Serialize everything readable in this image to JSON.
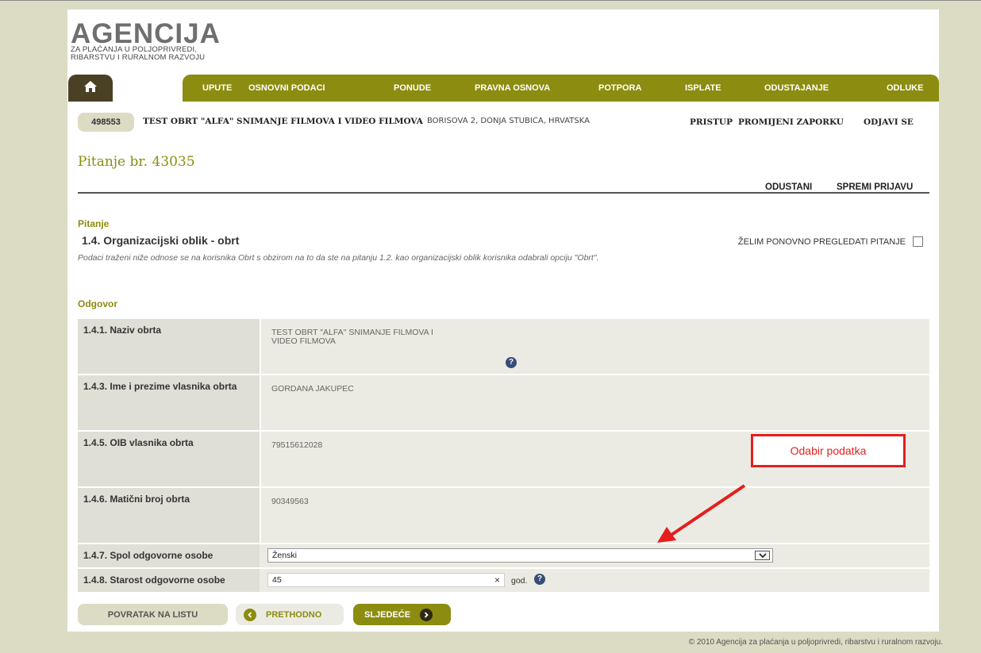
{
  "logo": {
    "main": "AGENCIJA",
    "line1": "ZA PLAĆANJA U POLJOPRIVREDI,",
    "line2": "RIBARSTVU I RURALNOM RAZVOJU"
  },
  "nav": {
    "home_icon": "home-icon",
    "items": [
      "UPUTE",
      "OSNOVNI PODACI",
      "PONUDE",
      "PRAVNA OSNOVA",
      "POTPORA",
      "ISPLATE",
      "ODUSTAJANJE",
      "ODLUKE"
    ]
  },
  "user": {
    "id": "498553",
    "name": "TEST OBRT \"ALFA\" SNIMANJE FILMOVA I VIDEO FILMOVA",
    "address": "BORISOVA 2, DONJA STUBICA, HRVATSKA",
    "links": [
      "PRISTUP",
      "PROMIJENI ZAPORKU",
      "ODJAVI SE"
    ]
  },
  "page": {
    "title": "Pitanje br. 43035",
    "actions": [
      "ODUSTANI",
      "SPREMI PRIJAVU"
    ]
  },
  "question": {
    "section_label": "Pitanje",
    "title": "1.4. Organizacijski oblik - obrt",
    "review_label": "ŽELIM PONOVNO PREGLEDATI PITANJE",
    "description": "Podaci traženi niže odnose se na korisnika Obrt s obzirom na to da ste na pitanju 1.2. kao organizacijski oblik korisnika odabrali opciju \"Obrt\"."
  },
  "answer": {
    "section_label": "Odgovor",
    "naziv": {
      "label": "1.4.1. Naziv obrta",
      "value_line1": "TEST OBRT \"ALFA\" SNIMANJE FILMOVA I",
      "value_line2": "VIDEO FILMOVA"
    },
    "ime": {
      "label": "1.4.3. Ime i prezime vlasnika obrta",
      "value": "GORDANA JAKUPEC"
    },
    "oib": {
      "label": "1.4.5. OIB vlasnika obrta",
      "value": "79515612028"
    },
    "maticni": {
      "label": "1.4.6. Matični broj obrta",
      "value": "90349563"
    },
    "spol": {
      "label": "1.4.7. Spol odgovorne osobe",
      "selected": "Ženski"
    },
    "starost": {
      "label": "1.4.8. Starost odgovorne osobe",
      "value": "45",
      "clear": "×",
      "unit": "god."
    },
    "help_glyph": "?"
  },
  "buttons": {
    "back": "POVRATAK NA LISTU",
    "prev": "PRETHODNO",
    "next": "SLJEDEĆE"
  },
  "annotation": {
    "text": "Odabir podatka",
    "color": "#e51e1e"
  },
  "footer": {
    "copyright": "© 2010 Agencija za plaćanja u poljoprivredi, ribarstvu i ruralnom razvoju."
  },
  "colors": {
    "brand_olive": "#8c8c10",
    "home_dark": "#4a4023",
    "background": "#dcdbc4"
  }
}
